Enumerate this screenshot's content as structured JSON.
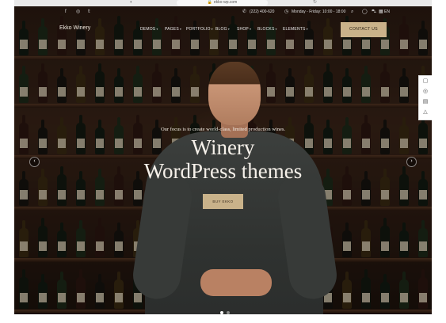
{
  "browser": {
    "url": "ekko-wp.com"
  },
  "topbar": {
    "phone": "(222) 400-620",
    "hours": "Monday - Friday: 10:00 - 18:00",
    "language": "EN"
  },
  "navbar": {
    "logo": "Ekko Winery",
    "items": [
      {
        "label": "DEMOS"
      },
      {
        "label": "PAGES"
      },
      {
        "label": "PORTFOLIO"
      },
      {
        "label": "BLOG"
      },
      {
        "label": "SHOP"
      },
      {
        "label": "BLOCKS"
      },
      {
        "label": "ELEMENTS"
      }
    ],
    "cta": "CONTACT US"
  },
  "hero": {
    "subtitle": "Our focus is to create world-class, limited production wines.",
    "title_line1": "Winery",
    "title_line2": "WordPress themes",
    "button": "BUY EKKO"
  },
  "slider": {
    "current_slide": 1,
    "slide_count": 2
  },
  "icons": {
    "social": [
      "facebook-icon",
      "instagram-icon",
      "twitter-icon"
    ],
    "side_tools": [
      "chat-icon",
      "support-icon",
      "doc-icon",
      "cart-icon"
    ]
  }
}
